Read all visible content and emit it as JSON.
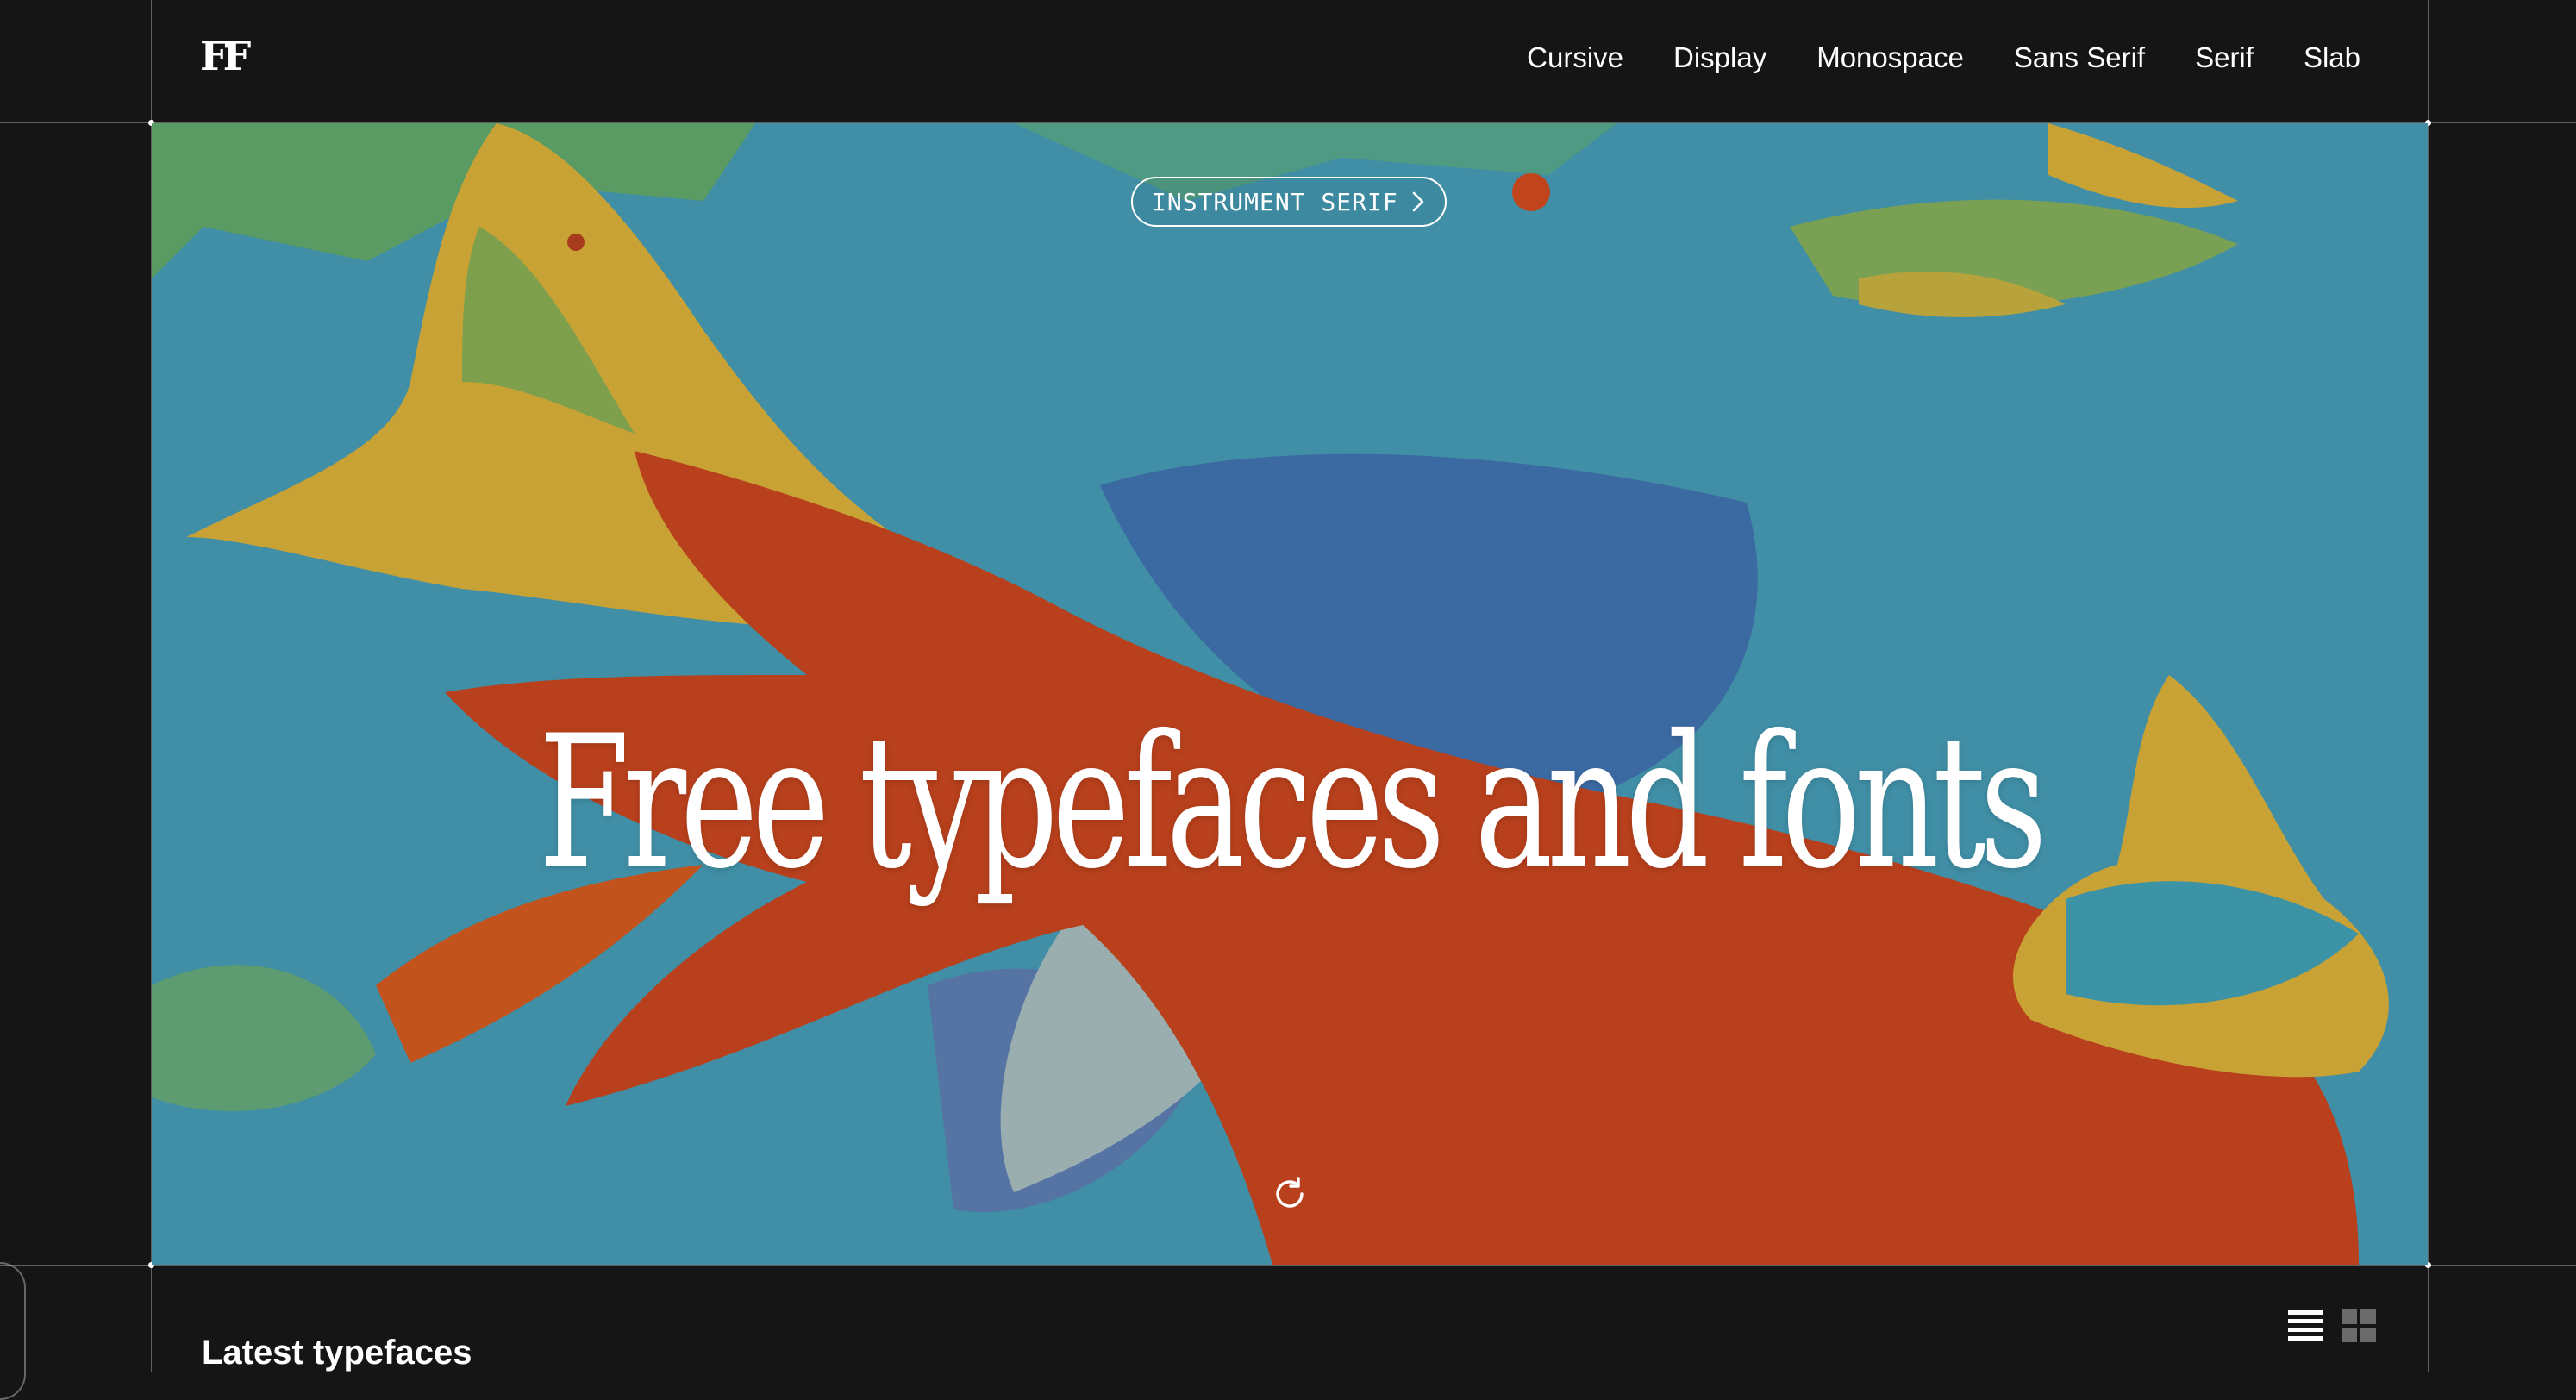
{
  "logo": {
    "text": "FF"
  },
  "nav": {
    "items": [
      {
        "label": "Cursive"
      },
      {
        "label": "Display"
      },
      {
        "label": "Monospace"
      },
      {
        "label": "Sans Serif"
      },
      {
        "label": "Serif"
      },
      {
        "label": "Slab"
      }
    ]
  },
  "hero": {
    "featured_font": "INSTRUMENT SERIF",
    "title": "Free typefaces and fonts"
  },
  "latest": {
    "title": "Latest typefaces"
  },
  "colors": {
    "background": "#151515",
    "hero_teal": "#3f8fa6",
    "hero_orange": "#b8401c",
    "hero_yellow": "#c9a235",
    "text": "#ffffff"
  },
  "icons": {
    "pill": "chevron-right-icon",
    "refresh": "refresh-icon",
    "list_view": "list-view-icon",
    "grid_view": "grid-view-icon"
  }
}
